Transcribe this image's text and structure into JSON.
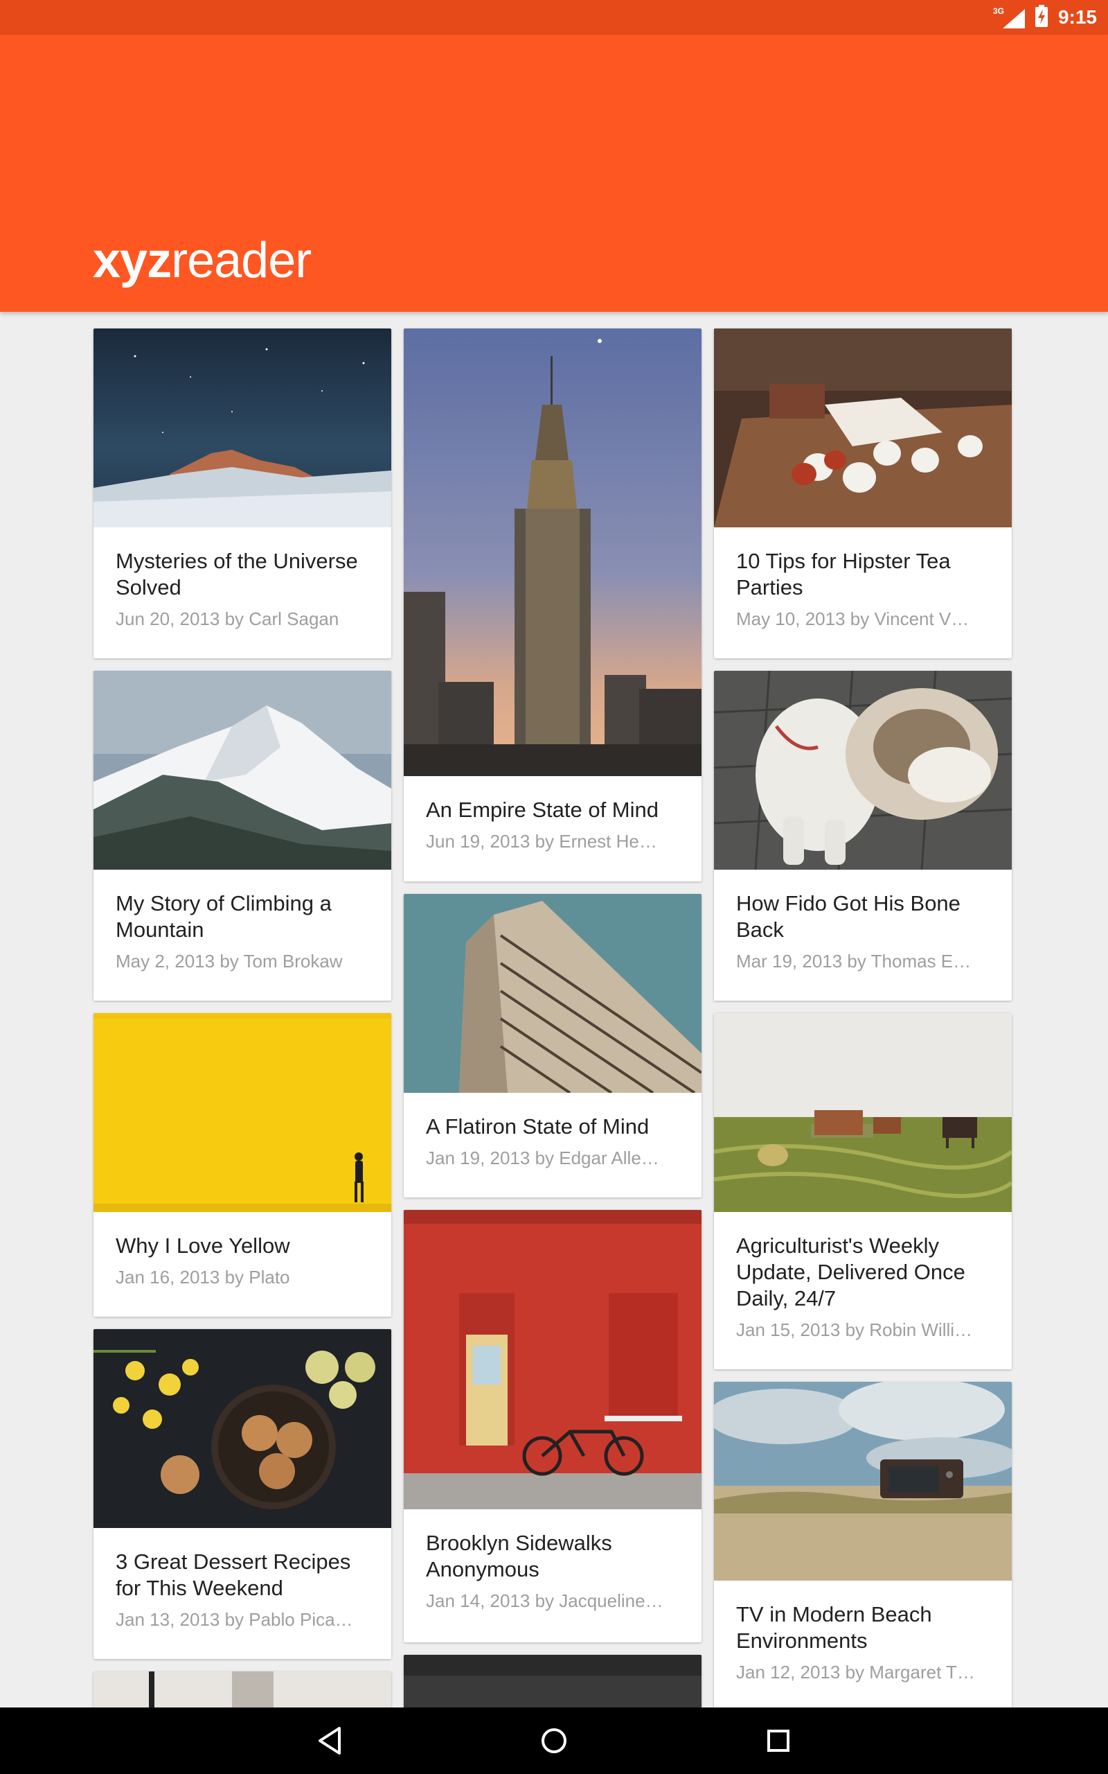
{
  "status_bar": {
    "network": "3G",
    "time": "9:15"
  },
  "app_bar": {
    "logo_bold": "xyz",
    "logo_regular": "reader"
  },
  "cards": [
    {
      "title": "Mysteries of the Universe Solved",
      "meta": "Jun 20, 2013 by Carl Sagan",
      "image": "night-sky-mountains"
    },
    {
      "title": "An Empire State of Mind",
      "meta": "Jun 19, 2013 by Ernest He…",
      "image": "empire-state-building"
    },
    {
      "title": "10 Tips for Hipster Tea Parties",
      "meta": "May 10, 2013 by Vincent V…",
      "image": "tea-cups-table"
    },
    {
      "title": "My Story of Climbing a Mountain",
      "meta": "May 2, 2013 by Tom Brokaw",
      "image": "snowy-mountain"
    },
    {
      "title": "How Fido Got His Bone Back",
      "meta": "Mar 19, 2013 by Thomas E…",
      "image": "bulldog"
    },
    {
      "title": "A Flatiron State of Mind",
      "meta": "Jan 19, 2013 by Edgar Alle…",
      "image": "flatiron-building"
    },
    {
      "title": "Why I Love Yellow",
      "meta": "Jan 16, 2013 by Plato",
      "image": "yellow-wall"
    },
    {
      "title": "Agriculturist's Weekly Update, Delivered Once Daily, 24/7",
      "meta": "Jan 15, 2013 by Robin Willi…",
      "image": "farm-field"
    },
    {
      "title": "Brooklyn Sidewalks Anonymous",
      "meta": "Jan 14, 2013 by Jacqueline…",
      "image": "red-brick-wall-bicycle"
    },
    {
      "title": "3 Great Dessert Recipes for This Weekend",
      "meta": "Jan 13, 2013 by Pablo Pica…",
      "image": "cookies-flowers"
    },
    {
      "title": "TV in Modern Beach Environments",
      "meta": "Jan 12, 2013 by Margaret T…",
      "image": "tv-on-beach"
    }
  ],
  "colors": {
    "primary": "#FF5722",
    "primary_dark": "#E64A19",
    "background": "#EEEEEE"
  },
  "nav_bar": {
    "back": "back-icon",
    "home": "home-icon",
    "recents": "recents-icon"
  }
}
